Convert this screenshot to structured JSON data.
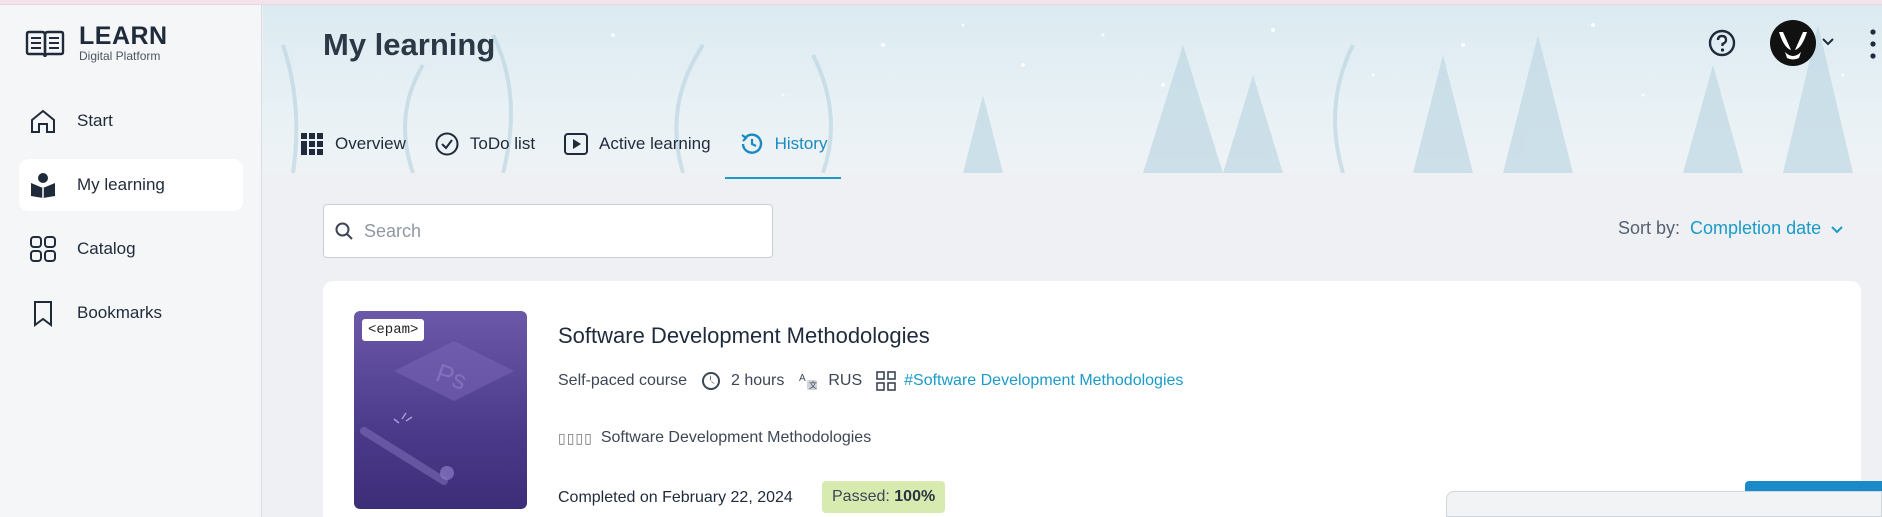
{
  "app": {
    "logo_title": "LEARN",
    "logo_subtitle": "Digital Platform"
  },
  "sidebar": {
    "items": [
      {
        "label": "Start",
        "icon": "home-icon",
        "active": false
      },
      {
        "label": "My learning",
        "icon": "learner-icon",
        "active": true
      },
      {
        "label": "Catalog",
        "icon": "grid-icon",
        "active": false
      },
      {
        "label": "Bookmarks",
        "icon": "bookmark-icon",
        "active": false
      }
    ]
  },
  "header": {
    "title": "My learning"
  },
  "tabs": [
    {
      "label": "Overview",
      "icon": "dashboard-icon",
      "active": false
    },
    {
      "label": "ToDo list",
      "icon": "check-circle-icon",
      "active": false
    },
    {
      "label": "Active learning",
      "icon": "play-icon",
      "active": false
    },
    {
      "label": "History",
      "icon": "history-icon",
      "active": true
    }
  ],
  "search": {
    "placeholder": "Search",
    "value": ""
  },
  "sort": {
    "label": "Sort by:",
    "value": "Completion date"
  },
  "course": {
    "badge": "<epam>",
    "title": "Software Development Methodologies",
    "type": "Self-paced course",
    "duration": "2 hours",
    "language": "RUS",
    "tag": "#Software Development Methodologies",
    "provider_glyphs": "▯▯▯▯",
    "provider": "Software Development Methodologies",
    "completed": "Completed on February 22, 2024",
    "passed_label": "Passed:",
    "passed_value": "100%"
  },
  "colors": {
    "accent": "#1a9bc8",
    "passed_bg": "#d7ebb0",
    "thumb": "#4b3a8a"
  }
}
